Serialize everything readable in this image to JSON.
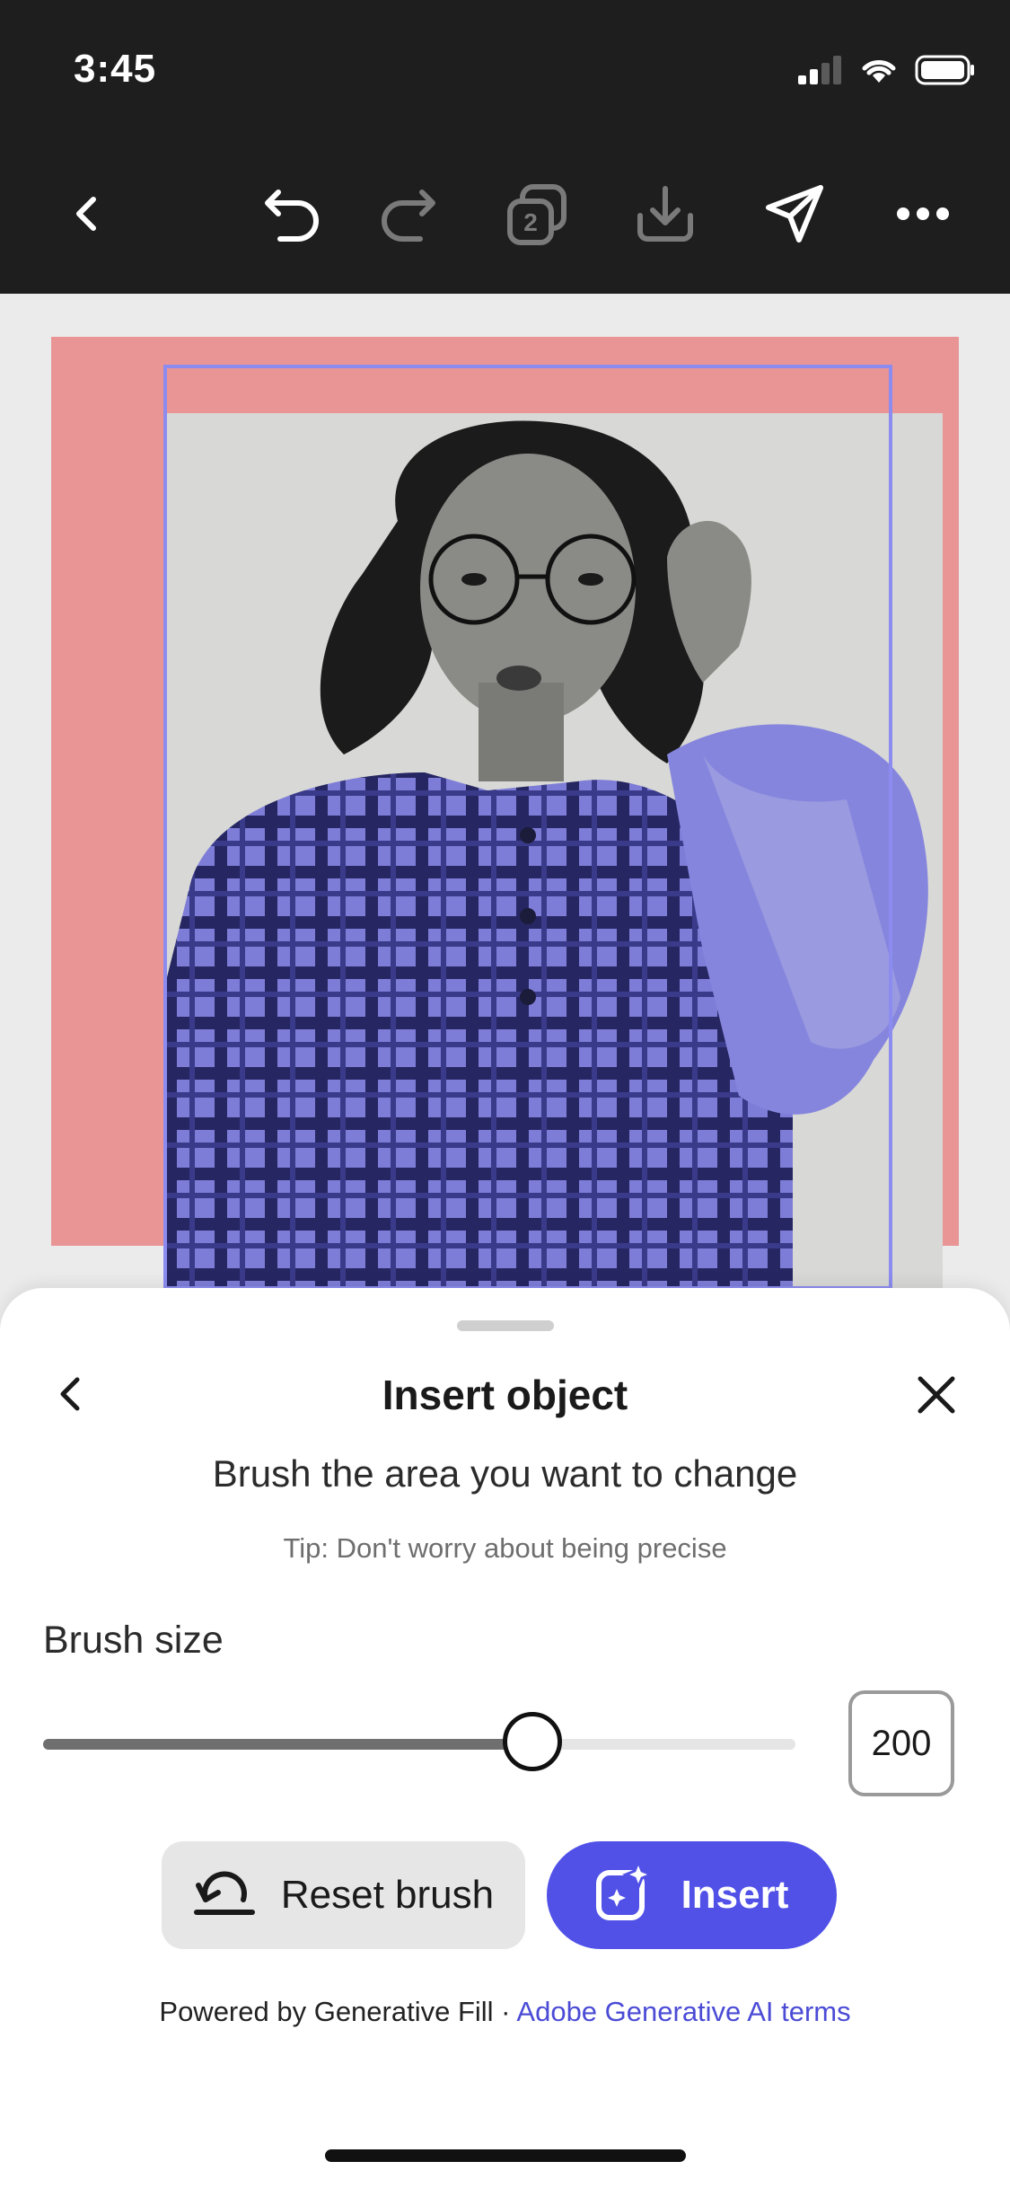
{
  "status_bar": {
    "time": "3:45"
  },
  "toolbar": {
    "icons": [
      "back-icon",
      "undo-icon",
      "redo-icon",
      "layers-icon",
      "download-icon",
      "share-icon",
      "more-icon"
    ],
    "layers_count": "2"
  },
  "colors": {
    "dark_bar": "#1e1e1e",
    "artboard": "#e99495",
    "selection_overlay": "#8c8cf0",
    "accent": "#5151e8",
    "link": "#4b4bd6"
  },
  "sheet": {
    "title": "Insert object",
    "subtitle": "Brush the area you want to change",
    "tip": "Tip: Don't worry about being precise",
    "brush_size_label": "Brush size",
    "brush_size_value": "200",
    "brush_slider_level": 0.65,
    "reset_button": "Reset brush",
    "insert_button": "Insert",
    "footer_text": "Powered by Generative Fill · ",
    "footer_link": "Adobe Generative AI terms"
  }
}
